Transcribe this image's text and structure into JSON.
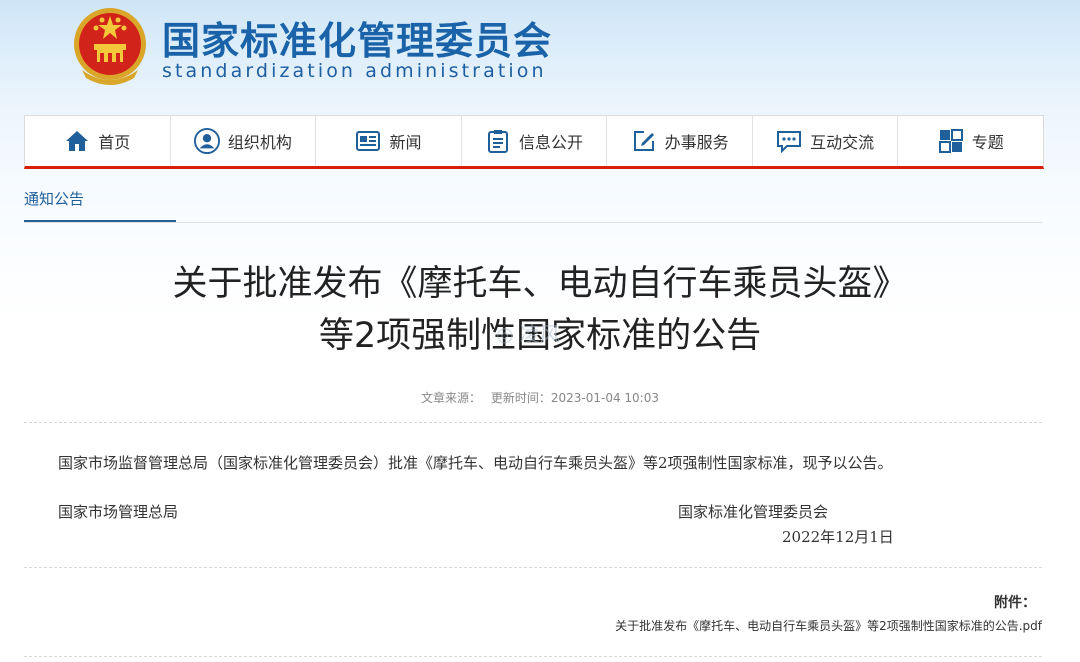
{
  "header": {
    "title": "国家标准化管理委员会",
    "subtitle": "standardization administration"
  },
  "nav": [
    {
      "label": "首页",
      "icon": "home-icon"
    },
    {
      "label": "组织机构",
      "icon": "person-icon"
    },
    {
      "label": "新闻",
      "icon": "newspaper-icon"
    },
    {
      "label": "信息公开",
      "icon": "clipboard-icon"
    },
    {
      "label": "办事服务",
      "icon": "edit-icon"
    },
    {
      "label": "互动交流",
      "icon": "chat-icon"
    },
    {
      "label": "专题",
      "icon": "topic-icon"
    }
  ],
  "breadcrumb": {
    "current": "通知公告"
  },
  "article": {
    "title_line1": "关于批准发布《摩托车、电动自行车乘员头盔》",
    "title_line2": "等2项强制性国家标准的公告",
    "source_label": "文章来源：",
    "updated": "更新时间：2023-01-04 10:03",
    "body": "国家市场监督管理总局（国家标准化管理委员会）批准《摩托车、电动自行车乘员头盔》等2项强制性国家标准，现予以公告。",
    "signer_left": "国家市场管理总局",
    "signer_right": "国家标准化管理委员会",
    "date": "2022年12月1日",
    "attachment_label": "附件：",
    "attachment_file": "关于批准发布《摩托车、电动自行车乘员头盔》等2项强制性国家标准的公告.pdf"
  },
  "watermark": "◎ 凌风",
  "colors": {
    "brand_blue": "#1b63a9",
    "accent_red": "#d81e06"
  }
}
